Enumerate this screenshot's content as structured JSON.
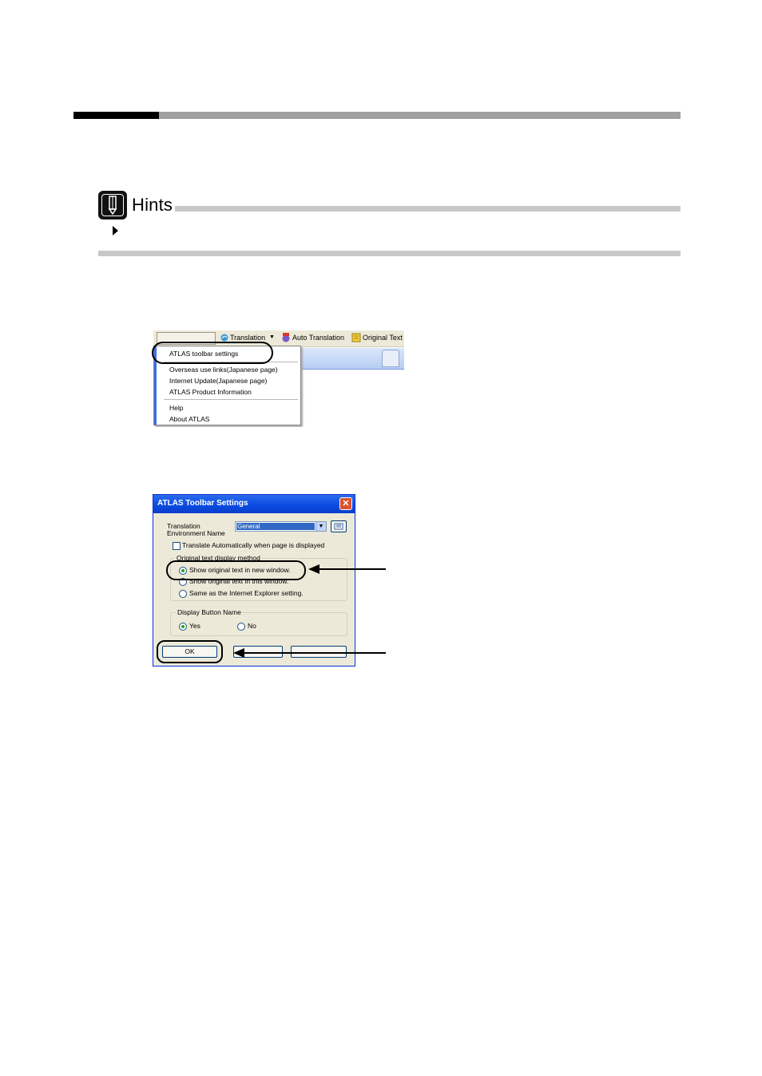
{
  "hints": {
    "title": "Hints",
    "icon": "pencil-note-icon"
  },
  "menu": {
    "toolbar_items": [
      "Translation",
      "Auto Translation",
      "Original Text"
    ],
    "items": [
      "ATLAS toolbar settings",
      "Overseas use links(Japanese page)",
      "Internet Update(Japanese page)",
      "ATLAS Product Information",
      "Help",
      "About ATLAS"
    ]
  },
  "dialog": {
    "title": "ATLAS Toolbar Settings",
    "env_label_line1": "Translation",
    "env_label_line2": "Environment Name",
    "env_value": "General",
    "auto_translate": "Translate Automatically when page is displayed",
    "display_group": "Original text display method",
    "radio_new_window": "Show original text in new window.",
    "radio_this_window": "Show original text in this window.",
    "radio_ie_setting": "Same as the Internet Explorer setting.",
    "button_group": "Display Button Name",
    "yes": "Yes",
    "no": "No",
    "ok": "OK",
    "colors": {
      "titlebar": "#0a4ae1",
      "face": "#ece9d8",
      "selection": "#316ac5"
    }
  }
}
